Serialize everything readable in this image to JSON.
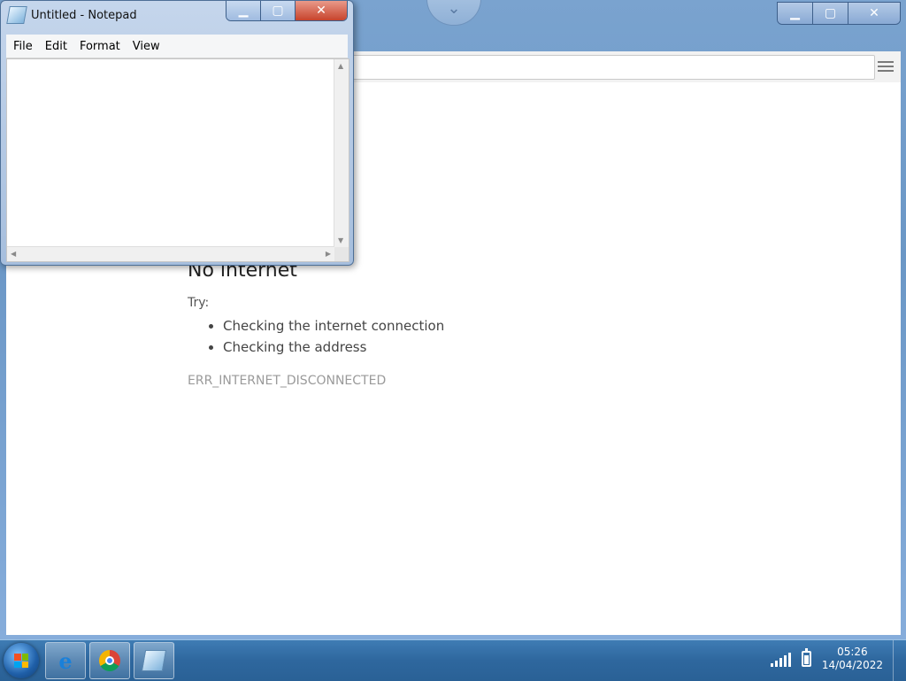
{
  "chrome": {
    "error": {
      "title": "No internet",
      "try_label": "Try:",
      "suggestions": [
        "Checking the internet connection",
        "Checking the address"
      ],
      "code": "ERR_INTERNET_DISCONNECTED"
    }
  },
  "notepad": {
    "title": "Untitled - Notepad",
    "menu": [
      "File",
      "Edit",
      "Format",
      "View"
    ]
  },
  "taskbar": {
    "time": "05:26",
    "date": "14/04/2022"
  }
}
